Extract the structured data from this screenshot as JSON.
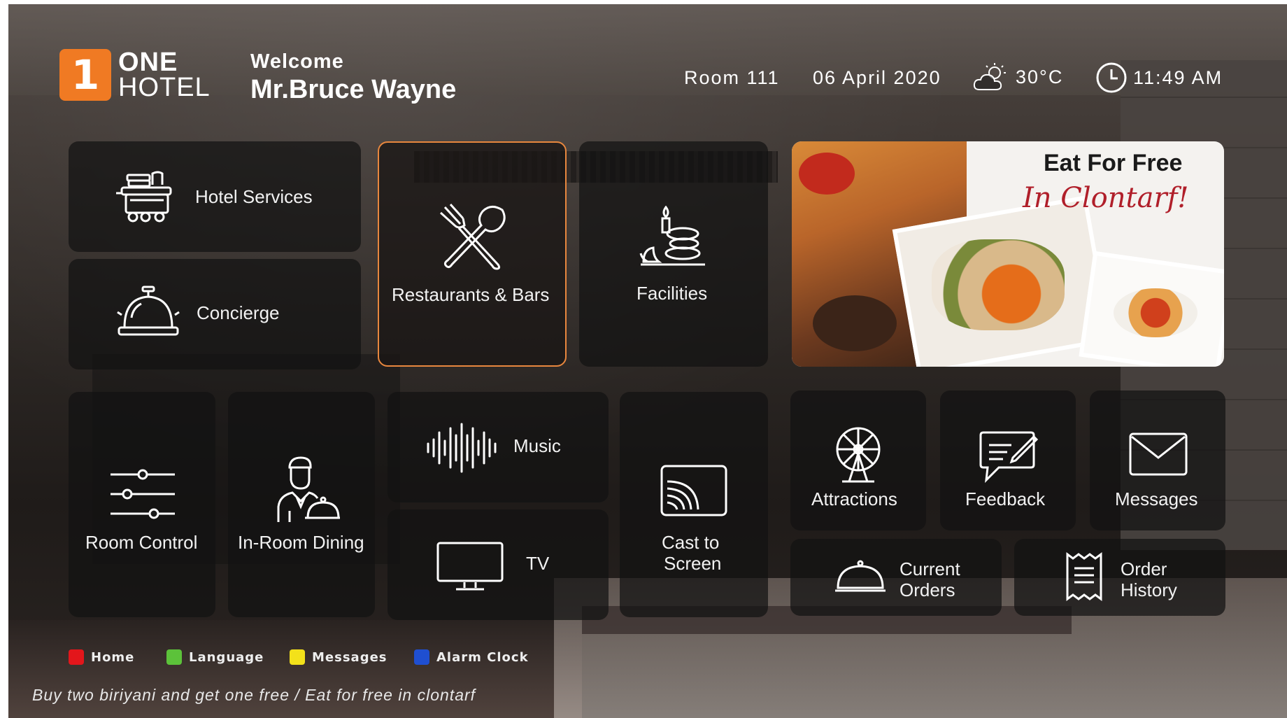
{
  "logo": {
    "badge": "1",
    "line1": "ONE",
    "line2": "HOTEL"
  },
  "welcome": {
    "label": "Welcome",
    "guest_name": "Mr.Bruce Wayne"
  },
  "status": {
    "room": "Room 111",
    "date": "06 April 2020",
    "temperature": "30°C",
    "time": "11:49 AM",
    "weather_icon": "partly-cloudy-icon",
    "clock_icon": "clock-icon"
  },
  "tiles": {
    "hotel_services": {
      "label": "Hotel Services",
      "icon": "service-cart-icon"
    },
    "concierge": {
      "label": "Concierge",
      "icon": "service-bell-icon"
    },
    "restaurants_bars": {
      "label": "Restaurants & Bars",
      "icon": "fork-spoon-icon"
    },
    "facilities": {
      "label": "Facilities",
      "icon": "spa-stones-icon"
    },
    "room_control": {
      "label": "Room Control",
      "icon": "sliders-icon"
    },
    "in_room_dining": {
      "label": "In-Room Dining",
      "icon": "waiter-icon"
    },
    "music": {
      "label": "Music",
      "icon": "sound-wave-icon"
    },
    "tv": {
      "label": "TV",
      "icon": "tv-icon"
    },
    "cast_to_screen": {
      "line1": "Cast to",
      "line2": "Screen",
      "icon": "cast-icon"
    },
    "attractions": {
      "label": "Attractions",
      "icon": "ferris-wheel-icon"
    },
    "feedback": {
      "label": "Feedback",
      "icon": "feedback-icon"
    },
    "messages": {
      "label": "Messages",
      "icon": "envelope-icon"
    },
    "current_orders": {
      "line1": "Current",
      "line2": "Orders",
      "icon": "cloche-icon"
    },
    "order_history": {
      "line1": "Order",
      "line2": "History",
      "icon": "receipt-icon"
    }
  },
  "promo": {
    "title": "Eat For Free",
    "subtitle": "In Clontarf!"
  },
  "legend": [
    {
      "label": "Home",
      "color": "#e3161b"
    },
    {
      "label": "Language",
      "color": "#5cc23a"
    },
    {
      "label": "Messages",
      "color": "#f3e11a"
    },
    {
      "label": "Alarm Clock",
      "color": "#1f4fd1"
    }
  ],
  "ticker": "Buy two biriyani and get one free /  Eat for free in clontarf",
  "colors": {
    "accent": "#f07a23",
    "selected_border": "#e8873e"
  }
}
